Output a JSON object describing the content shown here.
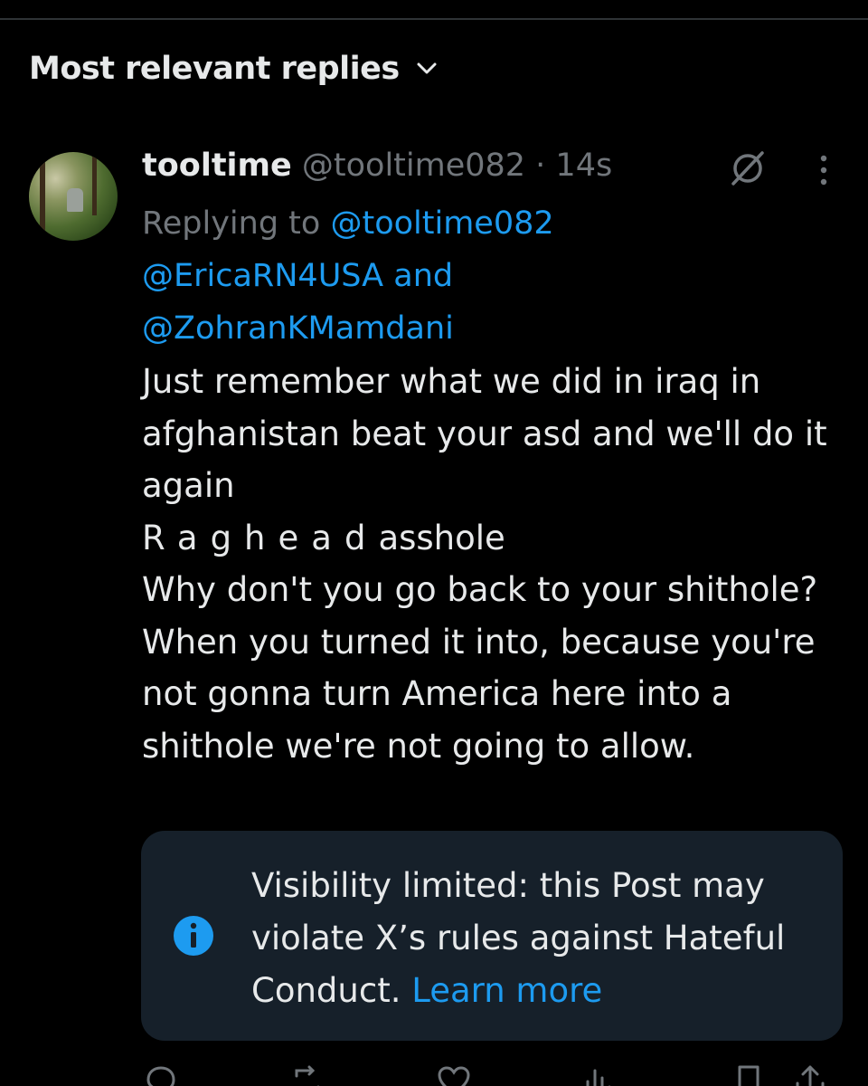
{
  "replies_header": {
    "sort_label": "Most relevant replies",
    "chevron_icon": "chevron-down-icon"
  },
  "post": {
    "display_name": "tooltime",
    "handle_time": "@tooltime082 · 14s",
    "grok_icon": "grok-icon",
    "more_icon": "more-options-icon",
    "replying_to_prefix": "Replying to",
    "replying_mentions": [
      "@tooltime082",
      "@EricaRN4USA",
      "@ZohranKMamdani"
    ],
    "replying_and": "and",
    "body": {
      "line1": "Just remember what we did in iraq in afghanistan beat your asd and we'll do it again",
      "line2_spaced": "Raghead",
      "line2_rest": "asshole",
      "line3": "Why don't you go back to your shithole? When you turned it into, because you're not gonna turn America here into a shithole we're not going to allow."
    }
  },
  "visibility_notice": {
    "info_icon": "info-icon",
    "text": "Visibility limited: this Post may violate X’s rules against Hateful Conduct.",
    "link_label": "Learn more"
  },
  "actions": {
    "icons": [
      "reply-icon",
      "repost-icon",
      "like-icon",
      "views-icon",
      "bookmark-icon",
      "share-icon"
    ]
  },
  "colors": {
    "background": "#000000",
    "primary_text": "#e7e9ea",
    "secondary_text": "#71767b",
    "accent_blue": "#1d9bf0",
    "notice_background": "#16202a",
    "divider": "#2f3336"
  }
}
